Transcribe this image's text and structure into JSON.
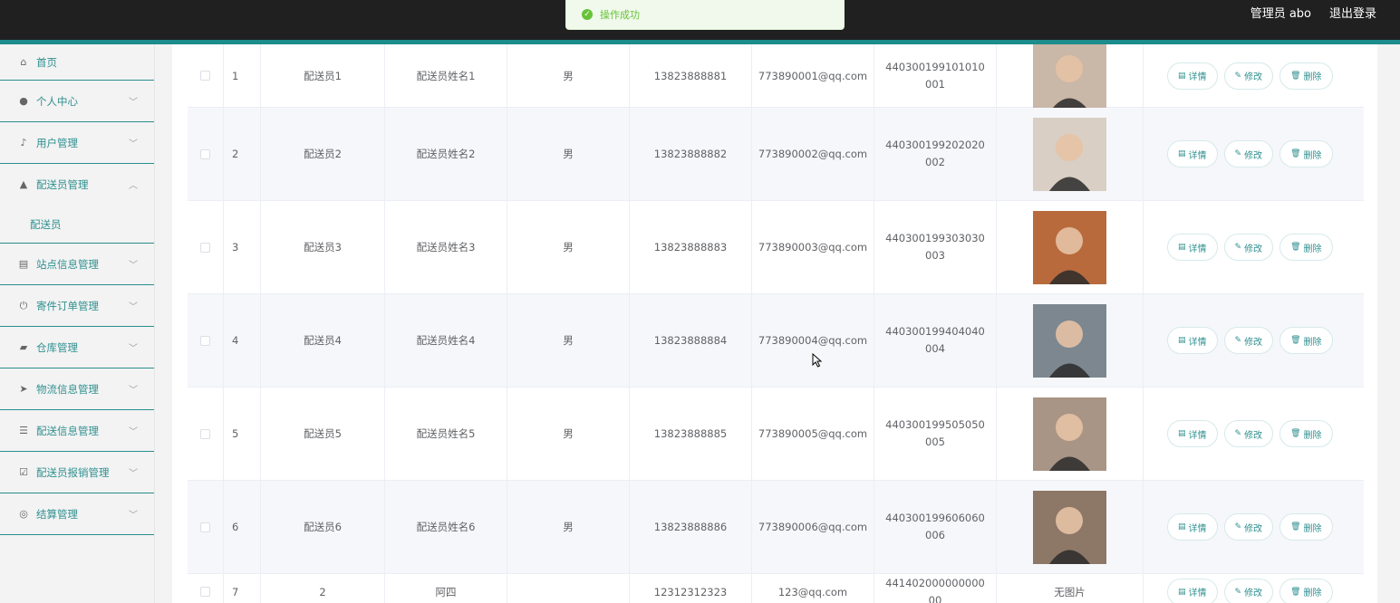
{
  "topbar": {
    "user": "管理员 abo",
    "logout": "退出登录"
  },
  "toast": {
    "text": "操作成功",
    "icon": "success-check-icon"
  },
  "sidebar": {
    "items": [
      {
        "label": "首页",
        "icon": "home-icon",
        "chevron": ""
      },
      {
        "label": "个人中心",
        "icon": "user-icon",
        "chevron": "﹀"
      },
      {
        "label": "用户管理",
        "icon": "mic-icon",
        "chevron": "﹀"
      },
      {
        "label": "配送员管理",
        "icon": "person-icon",
        "chevron": "︿"
      },
      {
        "label": "站点信息管理",
        "icon": "clipboard-icon",
        "chevron": "﹀"
      },
      {
        "label": "寄件订单管理",
        "icon": "power-icon",
        "chevron": "﹀"
      },
      {
        "label": "仓库管理",
        "icon": "folder-icon",
        "chevron": "﹀"
      },
      {
        "label": "物流信息管理",
        "icon": "send-icon",
        "chevron": "﹀"
      },
      {
        "label": "配送信息管理",
        "icon": "sliders-icon",
        "chevron": "﹀"
      },
      {
        "label": "配送员报销管理",
        "icon": "checklist-icon",
        "chevron": "﹀"
      },
      {
        "label": "结算管理",
        "icon": "compass-icon",
        "chevron": "﹀"
      }
    ],
    "submenu_label": "配送员"
  },
  "table": {
    "rows": [
      {
        "idx": "1",
        "account": "配送员1",
        "name": "配送员姓名1",
        "gender": "男",
        "phone": "13823888881",
        "email": "773890001@qq.com",
        "idcard": "440300199101010001",
        "photo_color": "#c9b7a7"
      },
      {
        "idx": "2",
        "account": "配送员2",
        "name": "配送员姓名2",
        "gender": "男",
        "phone": "13823888882",
        "email": "773890002@qq.com",
        "idcard": "440300199202020002",
        "photo_color": "#d9cfc4"
      },
      {
        "idx": "3",
        "account": "配送员3",
        "name": "配送员姓名3",
        "gender": "男",
        "phone": "13823888883",
        "email": "773890003@qq.com",
        "idcard": "440300199303030003",
        "photo_color": "#b86a3c"
      },
      {
        "idx": "4",
        "account": "配送员4",
        "name": "配送员姓名4",
        "gender": "男",
        "phone": "13823888884",
        "email": "773890004@qq.com",
        "idcard": "440300199404040004",
        "photo_color": "#7c8790"
      },
      {
        "idx": "5",
        "account": "配送员5",
        "name": "配送员姓名5",
        "gender": "男",
        "phone": "13823888885",
        "email": "773890005@qq.com",
        "idcard": "440300199505050005",
        "photo_color": "#a99585"
      },
      {
        "idx": "6",
        "account": "配送员6",
        "name": "配送员姓名6",
        "gender": "男",
        "phone": "13823888886",
        "email": "773890006@qq.com",
        "idcard": "440300199606060006",
        "photo_color": "#8d7767"
      },
      {
        "idx": "7",
        "account": "2",
        "name": "阿四",
        "gender": "",
        "phone": "12312312323",
        "email": "123@qq.com",
        "idcard": "44140200000000000",
        "photo_text": "无图片"
      }
    ],
    "actions": {
      "detail": "详情",
      "edit": "修改",
      "delete": "删除"
    }
  },
  "colors": {
    "accent": "#2f8f8f",
    "topbar": "#202020",
    "success": "#67c23a"
  }
}
